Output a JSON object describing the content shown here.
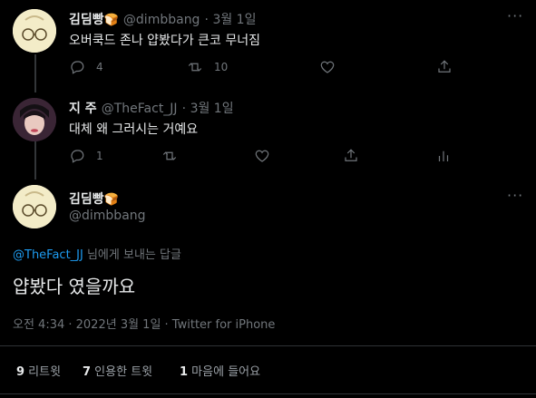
{
  "tweet1": {
    "name": "김딤빵",
    "handle": "@dimbbang",
    "date": "· 3월 1일",
    "text": "오버쿡드 존나 얍봤다가 큰코 무너짐",
    "replies": "4",
    "retweets": "10"
  },
  "tweet2": {
    "name": "지 주",
    "handle": "@TheFact_JJ",
    "date": "· 3월 1일",
    "text": "대체 왜 그러시는 거예요",
    "replies": "1"
  },
  "main": {
    "name": "김딤빵",
    "handle": "@dimbbang",
    "reply_to_mention": "@TheFact_JJ",
    "reply_to_suffix": " 님에게 보내는 답글",
    "text": "얍봤다 였을까요",
    "timestamp": "오전 4:34 · 2022년 3월 1일 · Twitter for iPhone",
    "retweet_count": "9",
    "retweet_label": " 리트윗",
    "quote_count": "7",
    "quote_label": " 인용한 트윗",
    "like_count": "1",
    "like_label": " 마음에 들어요"
  },
  "more_icon": "···",
  "emoji_bread": "🍞"
}
